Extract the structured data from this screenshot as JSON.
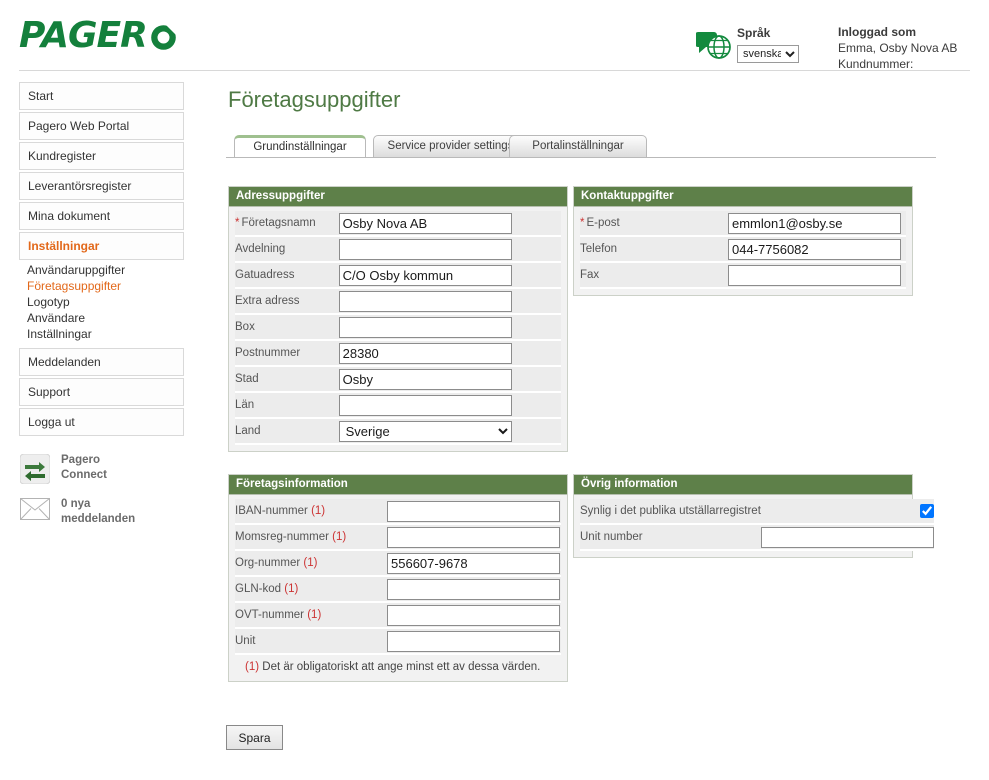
{
  "brand": {
    "logo_text": "PAGER",
    "logo_mark": "O",
    "color": "#14803c"
  },
  "header": {
    "language": {
      "label": "Språk",
      "selected": "svenska",
      "options": [
        "svenska"
      ],
      "icon": "globe-speech-icon"
    },
    "account": {
      "title": "Inloggad som",
      "user": "Emma, Osby Nova AB",
      "customer_number_label": "Kundnummer:"
    }
  },
  "sidebar": {
    "items": [
      {
        "label": "Start",
        "active": false
      },
      {
        "label": "Pagero Web Portal",
        "active": false
      },
      {
        "label": "Kundregister",
        "active": false
      },
      {
        "label": "Leverantörsregister",
        "active": false
      },
      {
        "label": "Mina dokument",
        "active": false
      },
      {
        "label": "Inställningar",
        "active": true
      },
      {
        "label": "Meddelanden",
        "active": false
      },
      {
        "label": "Support",
        "active": false
      },
      {
        "label": "Logga ut",
        "active": false
      }
    ],
    "submenu": [
      {
        "label": "Användaruppgifter",
        "active": false
      },
      {
        "label": "Företagsuppgifter",
        "active": true
      },
      {
        "label": "Logotyp",
        "active": false
      },
      {
        "label": "Användare",
        "active": false
      },
      {
        "label": "Inställningar",
        "active": false
      }
    ],
    "widgets": [
      {
        "icon": "sync-arrows-icon",
        "line1": "Pagero",
        "line2": "Connect"
      },
      {
        "icon": "envelope-icon",
        "line1": "0 nya",
        "line2": "meddelanden"
      }
    ]
  },
  "main": {
    "title": "Företagsuppgifter",
    "tabs": [
      {
        "label": "Grundinställningar",
        "active": true
      },
      {
        "label": "Service provider settings",
        "active": false
      },
      {
        "label": "Portalinställningar",
        "active": false
      }
    ],
    "panels": {
      "address": {
        "title": "Adressuppgifter",
        "rows": [
          {
            "label": "Företagsnamn",
            "required": true,
            "type": "text",
            "value": "Osby Nova AB"
          },
          {
            "label": "Avdelning",
            "required": false,
            "type": "text",
            "value": ""
          },
          {
            "label": "Gatuadress",
            "required": false,
            "type": "text",
            "value": "C/O Osby kommun"
          },
          {
            "label": "Extra adress",
            "required": false,
            "type": "text",
            "value": ""
          },
          {
            "label": "Box",
            "required": false,
            "type": "text",
            "value": ""
          },
          {
            "label": "Postnummer",
            "required": false,
            "type": "text",
            "value": "28380"
          },
          {
            "label": "Stad",
            "required": false,
            "type": "text",
            "value": "Osby"
          },
          {
            "label": "Län",
            "required": false,
            "type": "text",
            "value": ""
          },
          {
            "label": "Land",
            "required": false,
            "type": "select",
            "value": "Sverige",
            "options": [
              "Sverige"
            ]
          }
        ]
      },
      "contact": {
        "title": "Kontaktuppgifter",
        "rows": [
          {
            "label": "E-post",
            "required": true,
            "type": "text",
            "value": "emmlon1@osby.se"
          },
          {
            "label": "Telefon",
            "required": false,
            "type": "text",
            "value": "044-7756082"
          },
          {
            "label": "Fax",
            "required": false,
            "type": "text",
            "value": ""
          }
        ]
      },
      "company": {
        "title": "Företagsinformation",
        "rows": [
          {
            "label": "IBAN-nummer",
            "marker": "(1)",
            "type": "text",
            "value": ""
          },
          {
            "label": "Momsreg-nummer",
            "marker": "(1)",
            "type": "text",
            "value": ""
          },
          {
            "label": "Org-nummer",
            "marker": "(1)",
            "type": "text",
            "value": "556607-9678"
          },
          {
            "label": "GLN-kod",
            "marker": "(1)",
            "type": "text",
            "value": ""
          },
          {
            "label": "OVT-nummer",
            "marker": "(1)",
            "type": "text",
            "value": ""
          },
          {
            "label": "Unit",
            "marker": "",
            "type": "text",
            "value": ""
          }
        ],
        "note_marker": "(1)",
        "note_text": "Det är obligatoriskt att ange minst ett av dessa värden."
      },
      "other": {
        "title": "Övrig information",
        "checkbox": {
          "label": "Synlig i det publika utställarregistret",
          "checked": true
        },
        "rows": [
          {
            "label": "Unit number",
            "type": "text",
            "value": ""
          }
        ]
      }
    },
    "save_label": "Spara"
  }
}
